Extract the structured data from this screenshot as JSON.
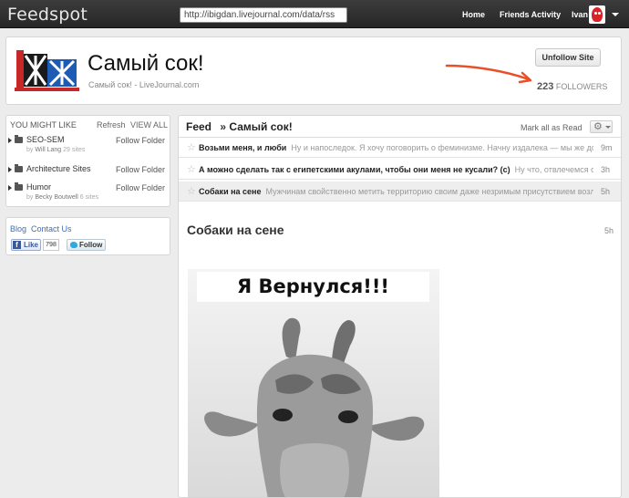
{
  "topbar": {
    "logo": "Feedspot",
    "url": "http://ibigdan.livejournal.com/data/rss",
    "nav": {
      "home": "Home",
      "friends": "Friends Activity",
      "user": "Ivan"
    }
  },
  "site": {
    "title": "Самый сок!",
    "subtitle": "Самый сок! - LiveJournal.com",
    "unfollow_label": "Unfollow Site",
    "followers_count": "223",
    "followers_label": "FOLLOWERS"
  },
  "sidebar": {
    "heading": "YOU MIGHT LIKE",
    "refresh": "Refresh",
    "view_all": "VIEW ALL",
    "folders": [
      {
        "name": "SEO-SEM",
        "by": "by",
        "author": "Will Lang",
        "sites": "29 sites",
        "follow": "Follow Folder"
      },
      {
        "name": "Architecture Sites",
        "follow": "Follow Folder"
      },
      {
        "name": "Humor",
        "by": "by",
        "author": "Becky Boutwell",
        "sites": "6 sites",
        "follow": "Follow Folder"
      }
    ]
  },
  "social": {
    "blog": "Blog",
    "contact": "Contact Us",
    "like_label": "Like",
    "like_count": "798",
    "follow_label": "Follow"
  },
  "feed": {
    "label": "Feed",
    "breadcrumb_sep": "»",
    "site": "Самый сок!",
    "mark_read": "Mark all as Read",
    "items": [
      {
        "title": "Возьми меня, и люби",
        "snippet": "Ну и напоследок. Я хочу поговорить о феминизме. Начну издалека — мы же договорились",
        "time": "9m"
      },
      {
        "title": "А можно сделать так с египетскими акулами, чтобы они меня не кусали? (с)",
        "snippet": "Ну что, отвлечемся от серьёзного",
        "time": "3h"
      },
      {
        "title": "Собаки на сене",
        "snippet": "Мужчинам свойственно метить территорию своим даже незримым присутствием возле тех",
        "time": "5h"
      }
    ]
  },
  "article": {
    "title": "Собаки на сене",
    "time": "5h",
    "image_caption": "Я Вернулся!!!"
  },
  "colors": {
    "topbar": "#2e2e2e",
    "accent_arrow": "#e8502a",
    "link": "#3b6fb6"
  }
}
